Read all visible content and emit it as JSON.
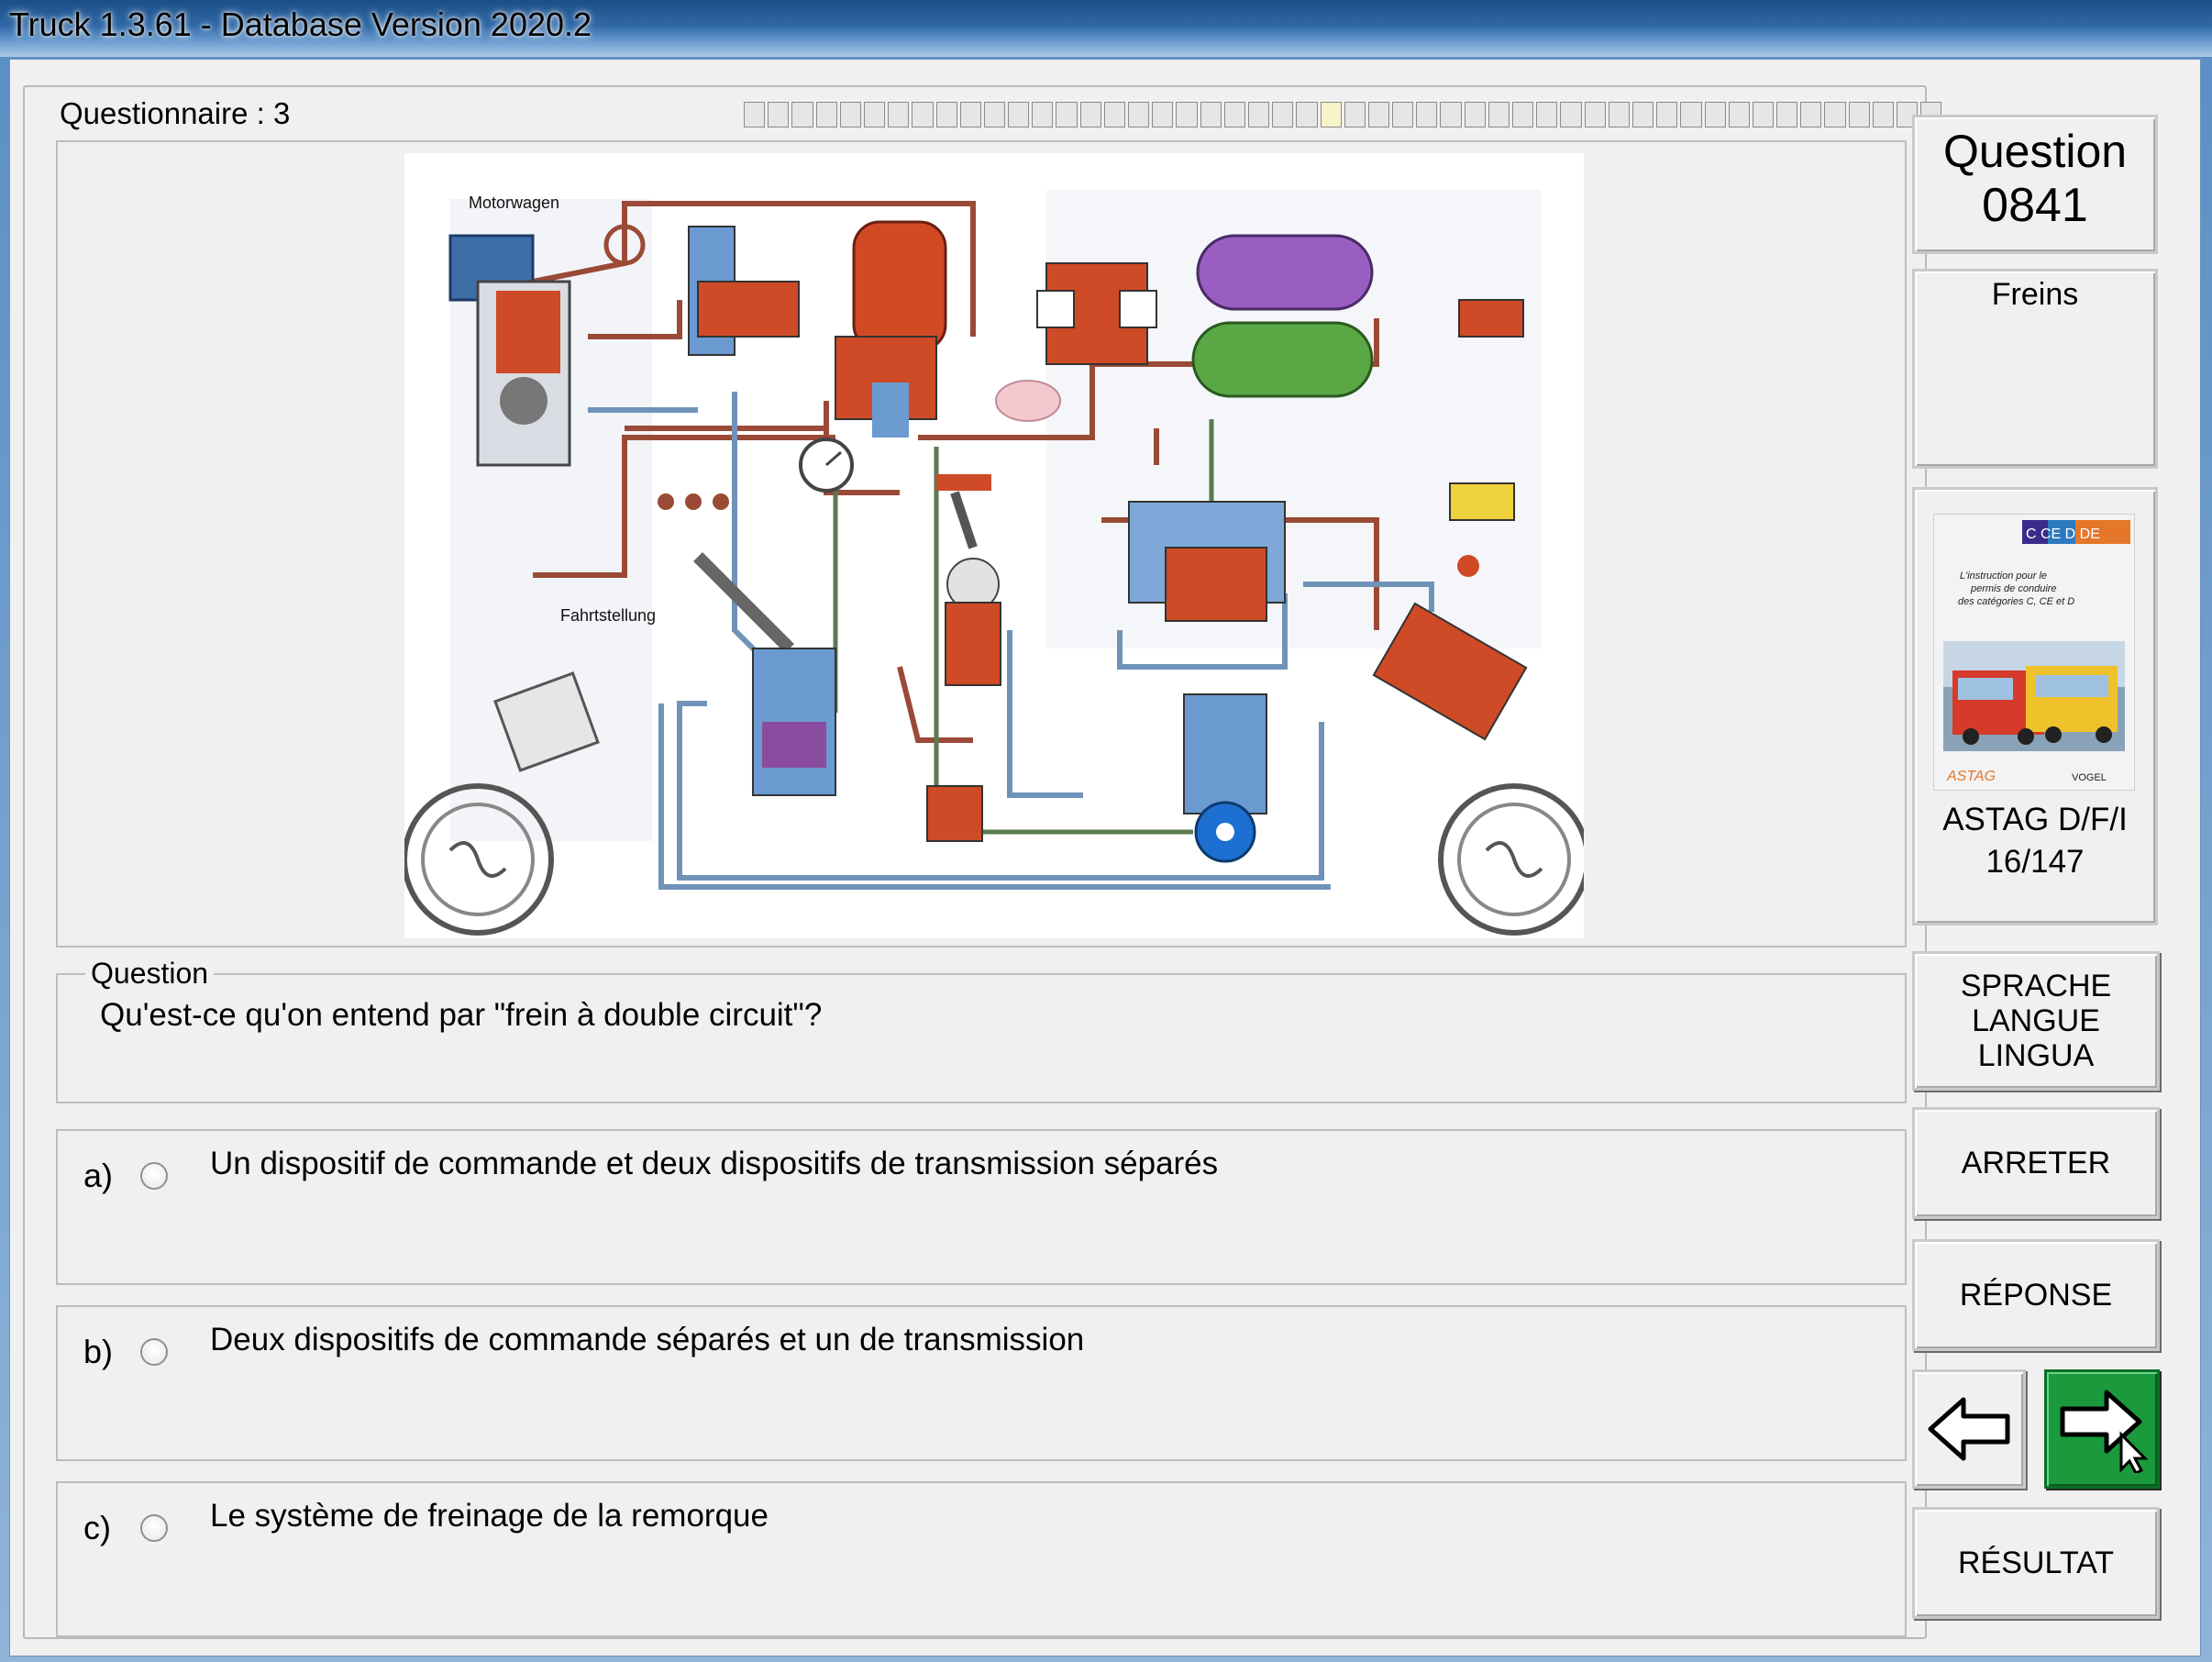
{
  "window": {
    "title": "Truck 1.3.61 - Database Version 2020.2"
  },
  "questionnaire": {
    "label": "Questionnaire : 3",
    "progress_total": 50,
    "progress_done": 25
  },
  "diagram": {
    "label_top": "Motorwagen",
    "label_mid": "Fahrtstellung"
  },
  "question": {
    "group_label": "Question",
    "text": "Qu'est-ce qu'on entend par \"frein à double circuit\"?"
  },
  "answers": [
    {
      "letter": "a)",
      "text": "Un dispositif de commande et deux dispositifs de transmission séparés"
    },
    {
      "letter": "b)",
      "text": "Deux dispositifs de commande séparés et un de transmission"
    },
    {
      "letter": "c)",
      "text": "Le système de freinage de la remorque"
    }
  ],
  "sidebar": {
    "question_title": "Question",
    "question_number": "0841",
    "category": "Freins",
    "book": {
      "badge": "C CE D DE",
      "cover_text": "L'instruction pour le permis de conduire des catégories C, CE et D",
      "source": "ASTAG D/F/I",
      "page": "16/147"
    },
    "language_button": [
      "SPRACHE",
      "LANGUE",
      "LINGUA"
    ],
    "stop_button": "ARRETER",
    "answer_button": "RÉPONSE",
    "result_button": "RÉSULTAT"
  },
  "colors": {
    "title_bar": "#2f68a6",
    "next_button": "#1a9a3c",
    "reservoir_1": "#9a5ec2",
    "reservoir_2": "#5aa845",
    "compressor_tank": "#d24a24",
    "pipe_brown": "#9a4a36",
    "pipe_blue": "#6f93b8",
    "pipe_green": "#5a7a52"
  }
}
